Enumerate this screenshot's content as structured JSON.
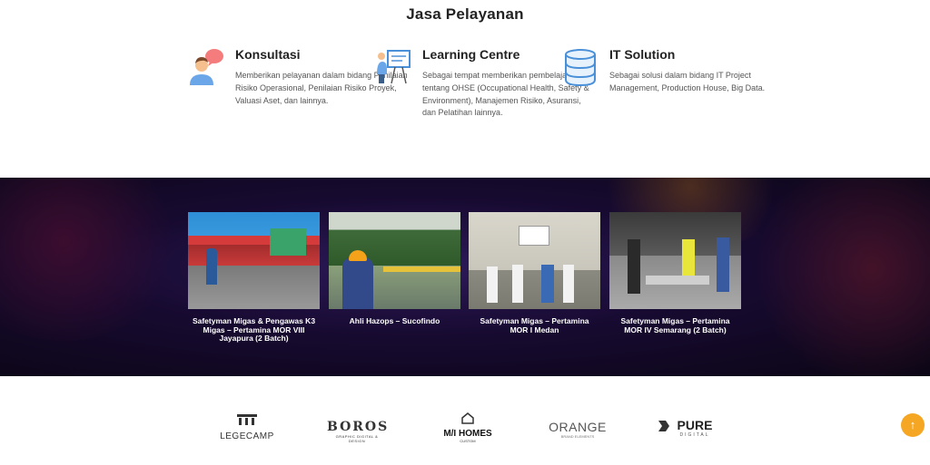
{
  "section": {
    "title": "Jasa Pelayanan"
  },
  "services": [
    {
      "title": "Konsultasi",
      "icon": "consultant-chat-icon",
      "description": "Memberikan pelayanan dalam bidang Penilaian Risiko Operasional, Penilaian Risiko Proyek, Valuasi Aset, dan lainnya."
    },
    {
      "title": "Learning Centre",
      "icon": "presentation-board-icon",
      "description": "Sebagai tempat memberikan pembelajaran tentang OHSE (Occupational Health, Safety & Environment), Manajemen Risiko, Asuransi, dan Pelatihan lainnya."
    },
    {
      "title": "IT Solution",
      "icon": "database-icon",
      "description": "Sebagai solusi dalam bidang IT Project Management, Production House, Big Data."
    }
  ],
  "gallery": [
    {
      "caption": "Safetyman Migas & Pengawas K3 Migas – Pertamina MOR VIII Jayapura (2 Batch)"
    },
    {
      "caption": "Ahli Hazops – Sucofindo"
    },
    {
      "caption": "Safetyman Migas – Pertamina MOR I Medan"
    },
    {
      "caption": "Safetyman Migas – Pertamina MOR IV Semarang (2 Batch)"
    }
  ],
  "clients": [
    {
      "name": "LEGECAMP"
    },
    {
      "name": "BOROS",
      "tagline": "GRAPHIC DIGITAL & DESIGN"
    },
    {
      "name": "M/I HOMES",
      "tagline": "CUSTOM"
    },
    {
      "name": "ORANGE",
      "tagline": "BRAND ELEMENTS"
    },
    {
      "name": "PURE",
      "tagline": "DIGITAL"
    }
  ],
  "scroll_top": {
    "icon": "arrow-up-icon",
    "symbol": "↑"
  },
  "colors": {
    "accent": "#f5a623",
    "band": "#170a30",
    "icon_blue": "#4a90d9"
  }
}
